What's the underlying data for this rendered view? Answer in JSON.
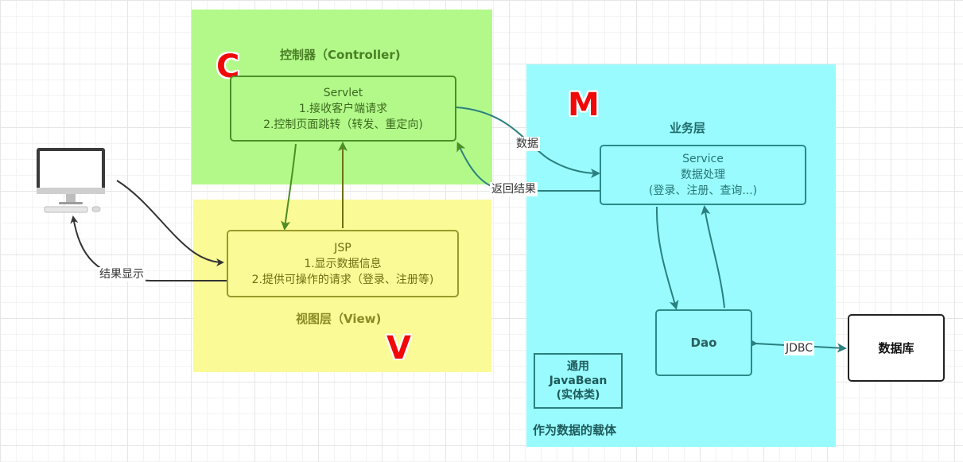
{
  "controller": {
    "title": "控制器（Controller)",
    "letter": "C",
    "servlet": {
      "name": "Servlet",
      "lines": [
        "1.接收客户端请求",
        "2.控制页面跳转（转发、重定向)"
      ]
    }
  },
  "view": {
    "title": "视图层（View)",
    "letter": "V",
    "jsp": {
      "name": "JSP",
      "lines": [
        "1.显示数据信息",
        "2.提供可操作的请求（登录、注册等)"
      ]
    }
  },
  "model": {
    "letter": "M",
    "business_title": "业务层",
    "service": {
      "name": "Service",
      "lines": [
        "数据处理",
        "(登录、注册、查询...)"
      ]
    },
    "dao": "Dao",
    "javabean": {
      "lines": [
        "通用",
        "JavaBean",
        "(实体类)"
      ]
    },
    "carrier_caption": "作为数据的载体"
  },
  "database": "数据库",
  "edges": {
    "data": "数据",
    "return_result": "返回结果",
    "result_display": "结果显示",
    "jdbc": "JDBC"
  },
  "colors": {
    "controller_region": "#b3f98a",
    "view_region": "#fafa96",
    "model_region": "#99fbfd",
    "letter_red": "#f10808"
  },
  "icons": {
    "client": "computer-monitor-icon"
  }
}
